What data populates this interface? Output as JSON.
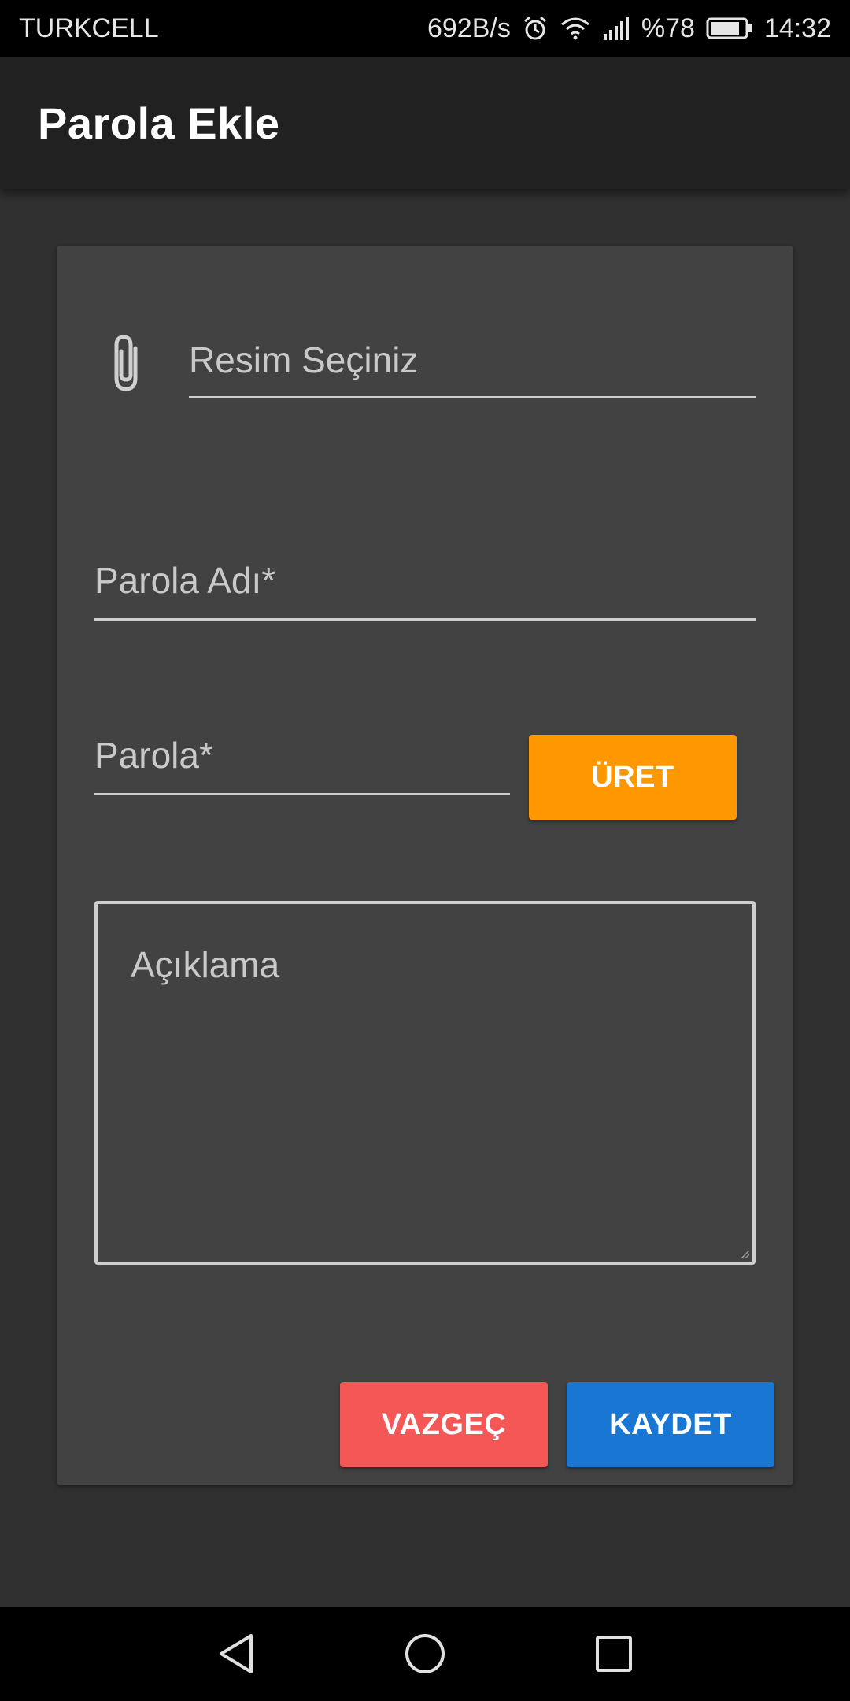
{
  "status_bar": {
    "carrier": "TURKCELL",
    "net_speed": "692B/s",
    "battery": "%78",
    "time": "14:32",
    "icons": [
      "alarm-icon",
      "wifi-icon",
      "signal-icon",
      "battery-icon"
    ]
  },
  "app_bar": {
    "title": "Parola Ekle"
  },
  "form": {
    "image_field": {
      "placeholder": "Resim Seçiniz",
      "icon": "paperclip-icon"
    },
    "name_field": {
      "placeholder": "Parola Adı*"
    },
    "password_field": {
      "placeholder": "Parola*"
    },
    "generate_button": "ÜRET",
    "description_field": {
      "placeholder": "Açıklama"
    },
    "cancel_button": "VAZGEÇ",
    "save_button": "KAYDET"
  },
  "colors": {
    "generate": "#ff9800",
    "cancel": "#f55656",
    "save": "#1976d2",
    "card": "#424242",
    "background": "#303030"
  },
  "nav_bar": {
    "icons": [
      "back-icon",
      "home-icon",
      "recents-icon"
    ]
  }
}
